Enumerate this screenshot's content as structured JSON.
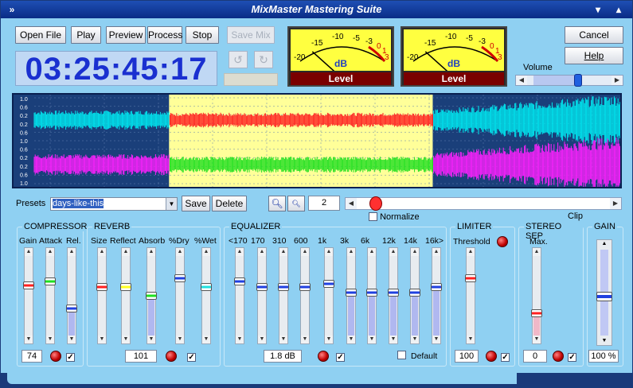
{
  "window": {
    "title": "MixMaster Mastering Suite"
  },
  "toolbar": {
    "open": "Open File",
    "play": "Play",
    "preview": "Preview",
    "process": "Process",
    "stop": "Stop",
    "save_mix": "Save Mix"
  },
  "dialog": {
    "cancel": "Cancel",
    "help": "Help"
  },
  "time_display": "03:25:45:17",
  "meters": [
    {
      "label": "Level",
      "unit": "dB",
      "scale": [
        "-20",
        "-15",
        "-10",
        "-5",
        "-3",
        "0",
        "1",
        "3"
      ],
      "level": 0.1
    },
    {
      "label": "Level",
      "unit": "dB",
      "scale": [
        "-20",
        "-15",
        "-10",
        "-5",
        "-3",
        "0",
        "1",
        "3"
      ],
      "level": 0.1
    }
  ],
  "volume": {
    "label": "Volume",
    "value": 0.6
  },
  "waveform": {
    "y_labels": [
      "1.0",
      "0.6",
      "0.2",
      "0.2",
      "0.6",
      "1.0",
      "0.6",
      "0.2",
      "0.2",
      "0.6",
      "1.0"
    ],
    "selection": [
      0.23,
      0.68
    ],
    "colors": {
      "ch1": "#00e8f0",
      "ch1_sel": "#ff2020",
      "ch2": "#ff20ff",
      "ch2_sel": "#20e020",
      "sel_bg": "#ffff99",
      "bg": "#1a3f7a"
    }
  },
  "presets": {
    "label": "Presets",
    "value": "days-like-this",
    "save": "Save",
    "delete": "Delete"
  },
  "zoom": {
    "value": "2",
    "zoom_in_icon": "zoom-in-icon",
    "zoom_out_icon": "zoom-out-icon"
  },
  "normalize": {
    "label": "Normalize",
    "checked": false
  },
  "clip_label": "Clip",
  "compressor": {
    "title": "COMPRESSOR",
    "labels": [
      "Gain",
      "Attack",
      "Rel."
    ],
    "value": "74",
    "checked": true,
    "sliders": [
      {
        "pos": 0.35,
        "fill": 0,
        "color": "#ff2020"
      },
      {
        "pos": 0.3,
        "fill": 0,
        "color": "#20e020"
      },
      {
        "pos": 0.68,
        "fill": 0.62,
        "color": "#2040e0"
      }
    ]
  },
  "reverb": {
    "title": "REVERB",
    "labels": [
      "Size",
      "Reflect",
      "Absorb",
      "%Dry",
      "%Wet"
    ],
    "value": "101",
    "checked": true,
    "sliders": [
      {
        "pos": 0.38,
        "fill": 0,
        "color": "#ff2020"
      },
      {
        "pos": 0.38,
        "fill": 0,
        "color": "#ffff20"
      },
      {
        "pos": 0.5,
        "fill": 0.45,
        "color": "#20e020"
      },
      {
        "pos": 0.25,
        "fill": 0,
        "color": "#2040e0"
      },
      {
        "pos": 0.38,
        "fill": 0,
        "color": "#20e0e0"
      }
    ]
  },
  "equalizer": {
    "title": "EQUALIZER",
    "labels": [
      "<170",
      "170",
      "310",
      "600",
      "1k",
      "3k",
      "6k",
      "12k",
      "14k",
      "16k>"
    ],
    "value": "1.8 dB",
    "checked": true,
    "default_label": "Default",
    "default_checked": false,
    "sliders": [
      0.3,
      0.38,
      0.38,
      0.38,
      0.33,
      0.45,
      0.45,
      0.45,
      0.45,
      0.38
    ]
  },
  "limiter": {
    "title": "LIMITER",
    "threshold_label": "Threshold",
    "value": "100",
    "checked": true,
    "slider_pos": 0.25
  },
  "stereo_sep": {
    "title": "STEREO SEP",
    "max_label": "Max.",
    "value": "0",
    "checked": true,
    "slider_pos": 0.75
  },
  "gain": {
    "title": "GAIN",
    "value": "100 %",
    "slider_pos": 0.55
  }
}
